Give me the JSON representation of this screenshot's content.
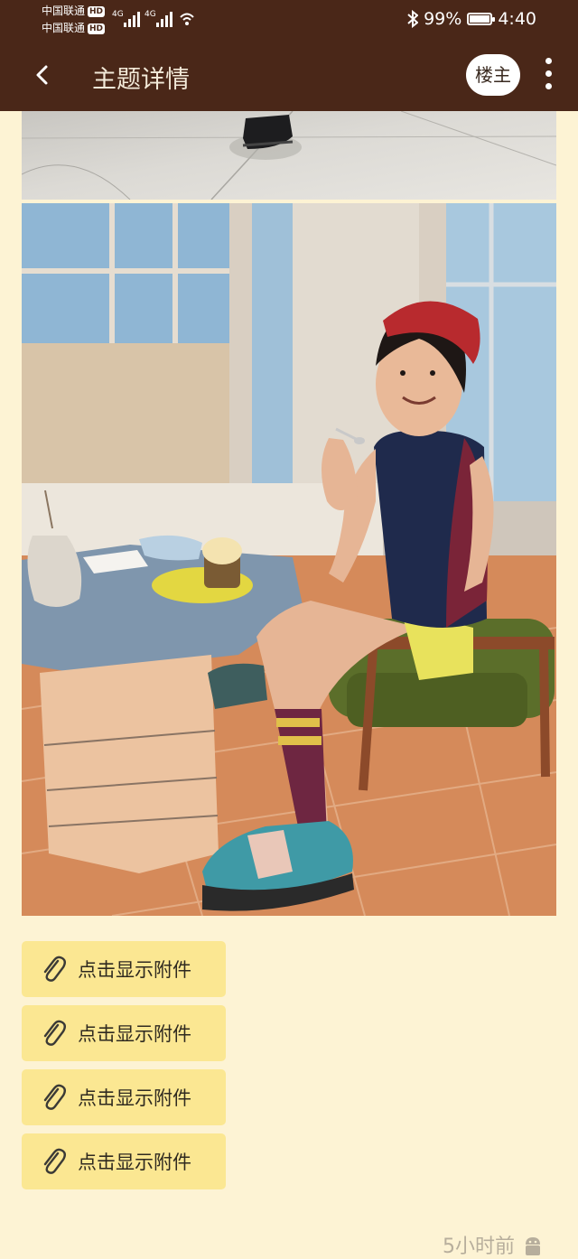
{
  "status_bar": {
    "carrier_1": "中国联通",
    "carrier_2": "中国联通",
    "hd_badge": "HD",
    "network_1": "4G",
    "network_2": "4G",
    "battery_percent": "99%",
    "time": "4:40",
    "battery_level": 0.99
  },
  "header": {
    "title": "主题详情",
    "owner_button": "楼主"
  },
  "attachments": [
    {
      "label": "点击显示附件"
    },
    {
      "label": "点击显示附件"
    },
    {
      "label": "点击显示附件"
    },
    {
      "label": "点击显示附件"
    }
  ],
  "footer": {
    "time_ago": "5小时前",
    "device_icon": "android-icon"
  },
  "colors": {
    "header_bg": "#4a2718",
    "page_bg": "#fdf3d4",
    "attachment_bg": "#fbe792"
  }
}
